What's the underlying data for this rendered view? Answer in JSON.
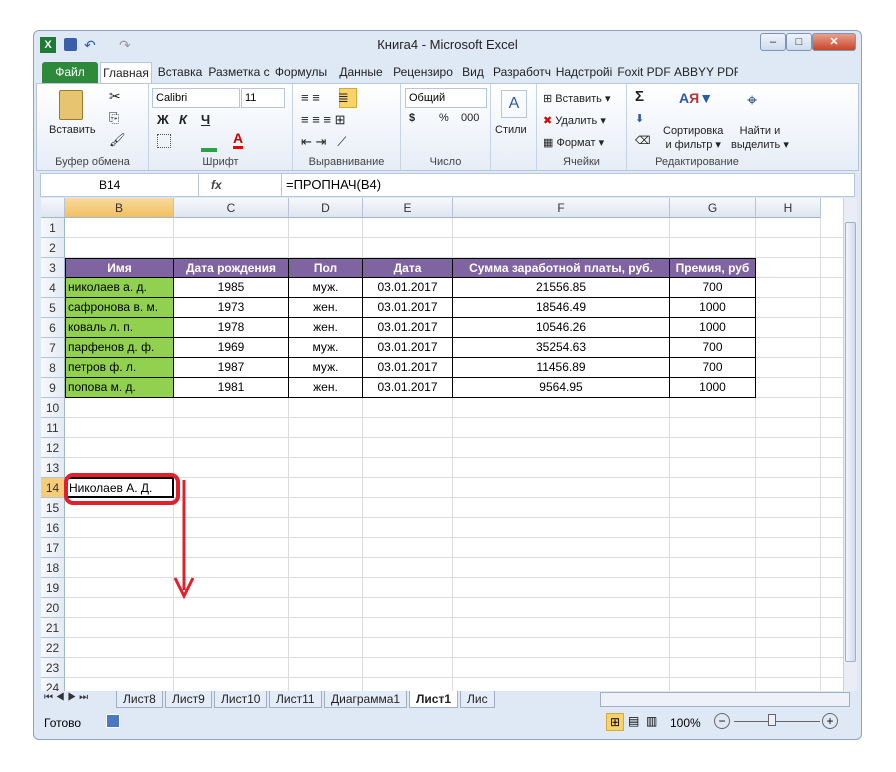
{
  "window": {
    "title": "Книга4  -  Microsoft Excel"
  },
  "tabs": [
    "Файл",
    "Главная",
    "Вставка",
    "Разметка с",
    "Формулы",
    "Данные",
    "Рецензиро",
    "Вид",
    "Разработч",
    "Надстройі",
    "Foxit PDF",
    "ABBYY PDF"
  ],
  "ribbon": {
    "clipboard": {
      "paste": "Вставить",
      "label": "Буфер обмена"
    },
    "font": {
      "name": "Calibri",
      "size": "11",
      "bold": "Ж",
      "italic": "К",
      "underline": "Ч",
      "label": "Шрифт"
    },
    "alignment": {
      "label": "Выравнивание"
    },
    "number": {
      "format": "Общий",
      "currency": "$",
      "percent": "%",
      "thousands": "000",
      "label": "Число"
    },
    "styles": {
      "label": "Стили"
    },
    "cells": {
      "insert": "Вставить",
      "delete": "Удалить",
      "format": "Формат",
      "label": "Ячейки"
    },
    "editing": {
      "sum": "Σ",
      "sort1": "Сортировка",
      "sort2": "и фильтр",
      "find1": "Найти и",
      "find2": "выделить",
      "label": "Редактирование"
    }
  },
  "formula_bar": {
    "name_box": "B14",
    "fx": "fx",
    "formula": "=ПРОПНАЧ(B4)"
  },
  "columns": [
    "B",
    "C",
    "D",
    "E",
    "F",
    "G",
    "H"
  ],
  "selected_column": "B",
  "rows": [
    "1",
    "2",
    "3",
    "4",
    "5",
    "6",
    "7",
    "8",
    "9",
    "10",
    "11",
    "12",
    "13",
    "14",
    "15",
    "16",
    "17",
    "18",
    "19",
    "20",
    "21",
    "22",
    "23",
    "24"
  ],
  "selected_row": "14",
  "table": {
    "headers": [
      "Имя",
      "Дата рождения",
      "Пол",
      "Дата",
      "Сумма заработной платы, руб.",
      "Премия, руб"
    ],
    "rows": [
      [
        "николаев а. д.",
        "1985",
        "муж.",
        "03.01.2017",
        "21556.85",
        "700"
      ],
      [
        "сафронова в. м.",
        "1973",
        "жен.",
        "03.01.2017",
        "18546.49",
        "1000"
      ],
      [
        "коваль л. п.",
        "1978",
        "жен.",
        "03.01.2017",
        "10546.26",
        "1000"
      ],
      [
        "парфенов д. ф.",
        "1969",
        "муж.",
        "03.01.2017",
        "35254.63",
        "700"
      ],
      [
        "петров ф. л.",
        "1987",
        "муж.",
        "03.01.2017",
        "11456.89",
        "700"
      ],
      [
        "попова м. д.",
        "1981",
        "жен.",
        "03.01.2017",
        "9564.95",
        "1000"
      ]
    ]
  },
  "active_cell": {
    "ref": "B14",
    "value": "Николаев А. Д."
  },
  "sheets": [
    "Лист8",
    "Лист9",
    "Лист10",
    "Лист11",
    "Диаграмма1",
    "Лист1",
    "Лис"
  ],
  "active_sheet": "Лист1",
  "status": {
    "ready": "Готово",
    "zoom": "100%"
  },
  "colors": {
    "header_bg": "#8064a2",
    "name_bg": "#92d050",
    "annotation": "#e0202a"
  }
}
